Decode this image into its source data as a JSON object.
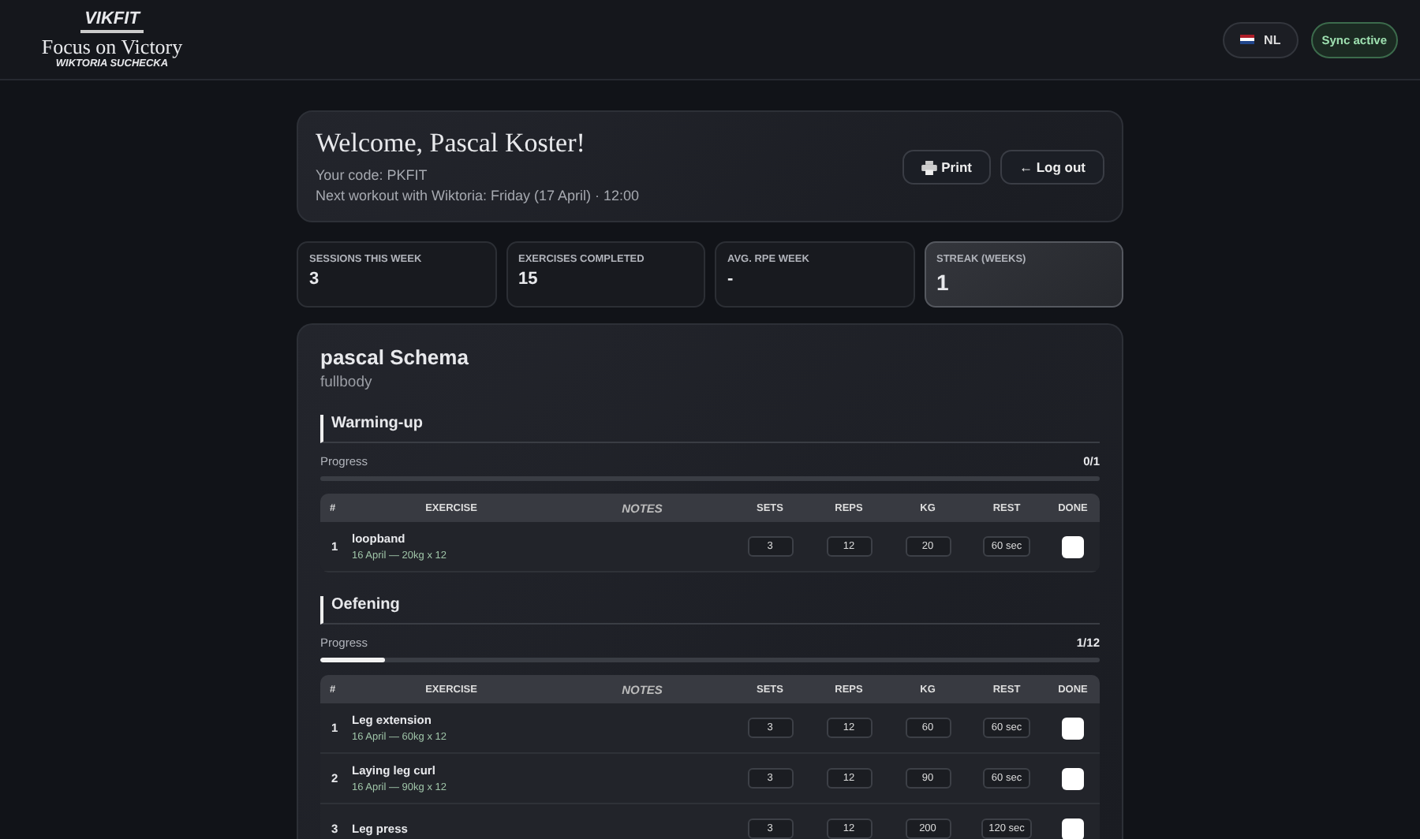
{
  "brand": {
    "name": "VIKFIT",
    "tagline": "Focus on Victory",
    "coach": "WIKTORIA SUCHECKA"
  },
  "header": {
    "language": "NL",
    "sync": "Sync active"
  },
  "welcome": {
    "title": "Welcome, Pascal Koster!",
    "code": "Your code: PKFIT",
    "next_workout": "Next workout with Wiktoria: Friday (17 April) · 12:00",
    "buttons": [
      {
        "kind": "print",
        "label": "Print"
      },
      {
        "kind": "logout",
        "label": "← Log out"
      }
    ]
  },
  "stats": [
    {
      "label": "SESSIONS THIS WEEK",
      "value": "3",
      "highlighted": false
    },
    {
      "label": "EXERCISES COMPLETED",
      "value": "15",
      "highlighted": false
    },
    {
      "label": "AVG. RPE WEEK",
      "value": "-",
      "highlighted": false
    },
    {
      "label": "STREAK (WEEKS)",
      "value": "1",
      "highlighted": true
    }
  ],
  "plan": {
    "title": "pascal Schema",
    "subtitle": "fullbody",
    "sections": [
      {
        "title": "Warming-up",
        "progress_label": "Progress",
        "progress_count": "0/1",
        "level": 0,
        "columns": [
          "#",
          "EXERCISE",
          "NOTES",
          "SETS",
          "REPS",
          "KG",
          "REST",
          "DONE"
        ],
        "rows": [
          {
            "number": "1",
            "exercise": "loopband",
            "history": "16 April — 20kg x 12",
            "sets": "3",
            "reps": "12",
            "kg": "20",
            "rest": "60 sec",
            "checked": false
          }
        ]
      },
      {
        "title": "Oefening",
        "progress_label": "Progress",
        "progress_count": "1/12",
        "level": 0.083,
        "columns": [
          "#",
          "EXERCISE",
          "NOTES",
          "SETS",
          "REPS",
          "KG",
          "REST",
          "DONE"
        ],
        "rows": [
          {
            "number": "1",
            "exercise": "Leg extension",
            "history": "16 April — 60kg x 12",
            "sets": "3",
            "reps": "12",
            "kg": "60",
            "rest": "60 sec",
            "checked": false
          },
          {
            "number": "2",
            "exercise": "Laying leg curl",
            "history": "16 April — 90kg x 12",
            "sets": "3",
            "reps": "12",
            "kg": "90",
            "rest": "60 sec",
            "checked": false
          },
          {
            "number": "3",
            "exercise": "Leg press",
            "sets": "3",
            "reps": "12",
            "kg": "200",
            "rest": "120 sec",
            "checked": false
          }
        ]
      }
    ]
  }
}
